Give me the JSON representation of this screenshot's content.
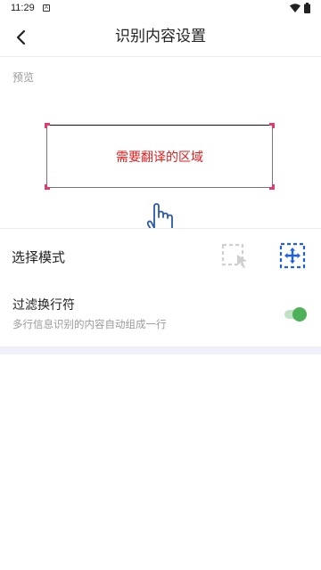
{
  "status_bar": {
    "time": "11:29",
    "notification_glyph": "A"
  },
  "app_bar": {
    "title": "识别内容设置",
    "back_icon": "chevron-left-icon"
  },
  "preview": {
    "label": "预览",
    "region_text": "需要翻译的区域",
    "region_text_color": "#e01e1e",
    "corner_color": "#e23a6e"
  },
  "mode": {
    "label": "选择模式",
    "options": [
      {
        "icon": "pointer-select-icon",
        "selected": false
      },
      {
        "icon": "move-select-icon",
        "selected": true
      }
    ],
    "accent": "#1f5fe0"
  },
  "filter": {
    "label": "过滤换行符",
    "description": "多行信息识别的内容自动组成一行",
    "enabled": true,
    "toggle_color": "#4cb157"
  }
}
